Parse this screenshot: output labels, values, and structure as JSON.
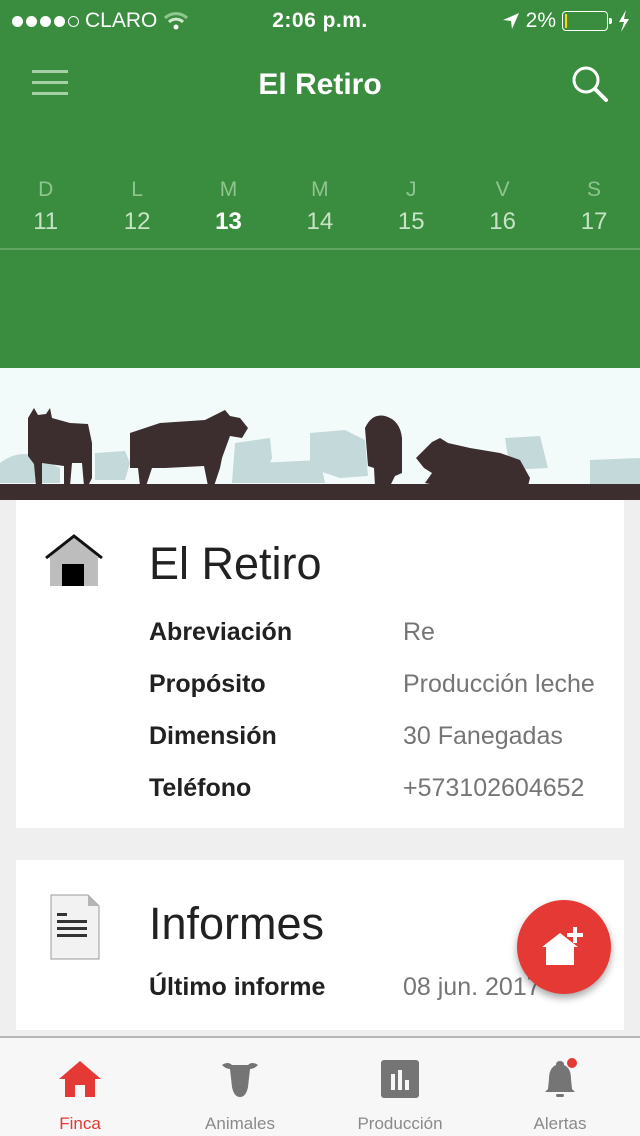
{
  "status_bar": {
    "signal_filled": 4,
    "signal_total": 5,
    "carrier": "CLARO",
    "time": "2:06 p.m.",
    "battery_percent_label": "2%",
    "battery_level": 0.02
  },
  "app_bar": {
    "title": "El Retiro",
    "menu_icon": "hamburger-icon",
    "search_icon": "search-icon"
  },
  "calendar": {
    "days": [
      {
        "dow": "D",
        "num": "11",
        "today": false
      },
      {
        "dow": "L",
        "num": "12",
        "today": false
      },
      {
        "dow": "M",
        "num": "13",
        "today": true
      },
      {
        "dow": "M",
        "num": "14",
        "today": false
      },
      {
        "dow": "J",
        "num": "15",
        "today": false
      },
      {
        "dow": "V",
        "num": "16",
        "today": false
      },
      {
        "dow": "S",
        "num": "17",
        "today": false
      }
    ]
  },
  "banner": {
    "image": "cattle-silhouette-banner"
  },
  "farm_card": {
    "icon": "house-icon",
    "title": "El Retiro",
    "rows": [
      {
        "label": "Abreviación",
        "value": "Re"
      },
      {
        "label": "Propósito",
        "value": "Producción leche"
      },
      {
        "label": "Dimensión",
        "value": "30 Fanegadas"
      },
      {
        "label": "Teléfono",
        "value": "+573102604652"
      }
    ]
  },
  "reports_card": {
    "icon": "document-icon",
    "title": "Informes",
    "rows": [
      {
        "label": "Último informe",
        "value": "08 jun. 2017"
      }
    ]
  },
  "fab": {
    "icon": "add-house-icon"
  },
  "tab_bar": {
    "tabs": [
      {
        "label": "Finca",
        "icon": "home-icon",
        "active": true
      },
      {
        "label": "Animales",
        "icon": "cow-icon",
        "active": false
      },
      {
        "label": "Producción",
        "icon": "bar-chart-icon",
        "active": false
      },
      {
        "label": "Alertas",
        "icon": "bell-icon",
        "active": false,
        "badge": true
      }
    ]
  },
  "colors": {
    "primary_green": "#3a8d3e",
    "accent_red": "#e53935"
  }
}
